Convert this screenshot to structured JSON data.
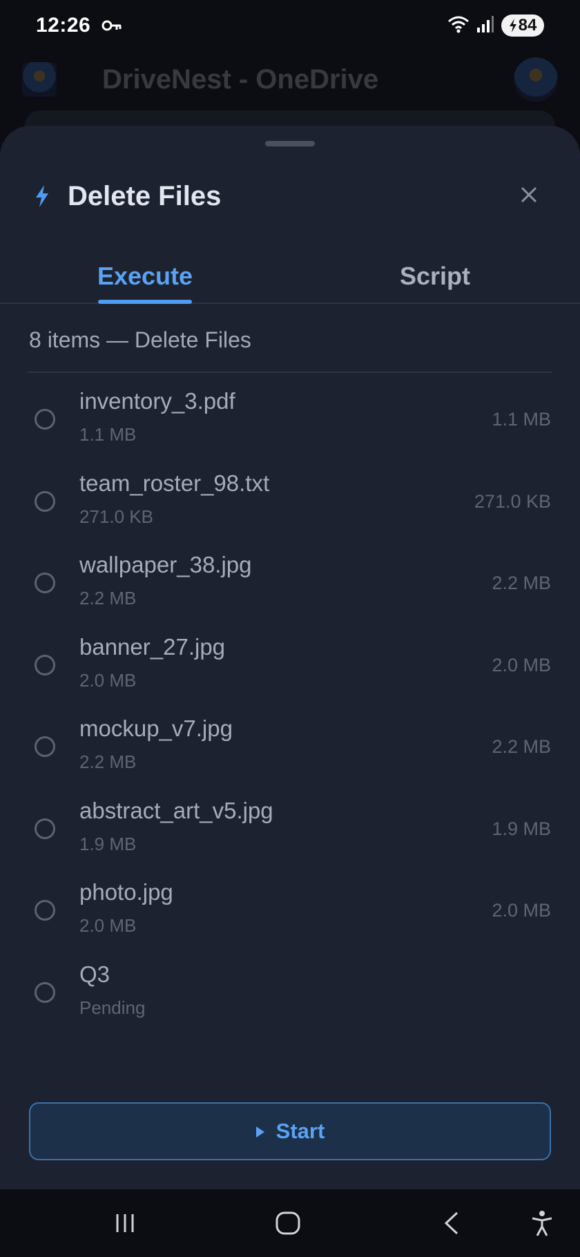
{
  "status_bar": {
    "time": "12:26",
    "battery": "84",
    "icons": [
      "key-icon",
      "wifi-icon",
      "signal-icon",
      "battery-icon"
    ]
  },
  "app_bar": {
    "title": "DriveNest - OneDrive"
  },
  "sheet": {
    "title": "Delete Files",
    "title_icon": "bolt-icon",
    "close_icon": "close-icon",
    "tabs": [
      {
        "label": "Execute",
        "active": true
      },
      {
        "label": "Script",
        "active": false
      }
    ],
    "summary": "8 items — Delete Files",
    "files": [
      {
        "name": "inventory_3.pdf",
        "subtitle": "1.1 MB",
        "size": "1.1 MB"
      },
      {
        "name": "team_roster_98.txt",
        "subtitle": "271.0 KB",
        "size": "271.0 KB"
      },
      {
        "name": "wallpaper_38.jpg",
        "subtitle": "2.2 MB",
        "size": "2.2 MB"
      },
      {
        "name": "banner_27.jpg",
        "subtitle": "2.0 MB",
        "size": "2.0 MB"
      },
      {
        "name": "mockup_v7.jpg",
        "subtitle": "2.2 MB",
        "size": "2.2 MB"
      },
      {
        "name": "abstract_art_v5.jpg",
        "subtitle": "1.9 MB",
        "size": "1.9 MB"
      },
      {
        "name": "photo.jpg",
        "subtitle": "2.0 MB",
        "size": "2.0 MB"
      },
      {
        "name": "Q3",
        "subtitle": "Pending",
        "size": ""
      }
    ],
    "start_label": "Start"
  },
  "colors": {
    "accent": "#5aa2f2",
    "sheet_bg": "#1d2230",
    "text_primary": "#e1e6f0",
    "text_muted": "#5f6574"
  }
}
